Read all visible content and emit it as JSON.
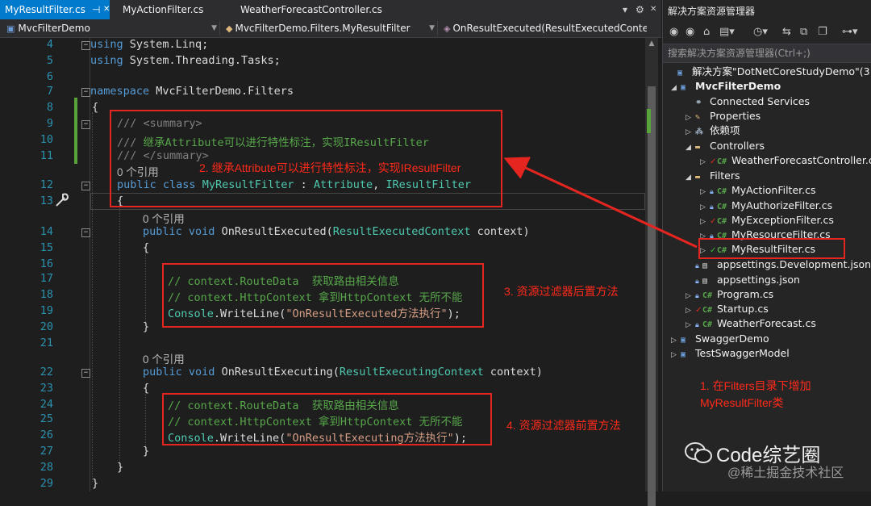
{
  "tabs": [
    {
      "label": "MyResultFilter.cs",
      "pin": "⊣",
      "close": "✕",
      "active": true
    },
    {
      "label": "MyActionFilter.cs",
      "active": false
    },
    {
      "label": "WeatherForecastController.cs",
      "active": false
    }
  ],
  "tab_controls": {
    "dropdown": "▾",
    "settings": "⚙",
    "close": "✕"
  },
  "navbar": {
    "project": "MvcFilterDemo",
    "type": "MvcFilterDemo.Filters.MyResultFilter",
    "member": "OnResultExecuted(ResultExecutedContext"
  },
  "code": {
    "line_numbers": [
      "4",
      "5",
      "6",
      "7",
      "8",
      "9",
      "10",
      "11",
      "12",
      "13",
      "14",
      "15",
      "16",
      "17",
      "18",
      "19",
      "20",
      "21",
      "22",
      "23",
      "24",
      "25",
      "26",
      "27",
      "28",
      "29"
    ],
    "using_kw": "using",
    "using1": "System.Linq;",
    "using2": "System.Threading.Tasks;",
    "namespace_kw": "namespace",
    "namespace_name": "MvcFilterDemo.Filters",
    "brace_open": "{",
    "brace_close": "}",
    "summary_prefix": "///",
    "summary_open": "<summary>",
    "summary_text": "继承Attribute可以进行特性标注，实现IResultFilter",
    "summary_close": "</summary>",
    "refs": "0 个引用",
    "public_kw": "public",
    "class_kw": "class",
    "class_name": "MyResultFilter",
    "colon": ":",
    "base1": "Attribute",
    "comma": ",",
    "base2": "IResultFilter",
    "void_kw": "void",
    "m1_name": "OnResultExecuted",
    "m1_ptype": "ResultExecutedContext",
    "param": "context)",
    "paren": "(",
    "m2_name": "OnResultExecuting",
    "m2_ptype": "ResultExecutingContext",
    "comment1": "// context.RouteData  获取路由相关信息",
    "comment2": "// context.HttpContext 拿到HttpContext 无所不能",
    "console": "Console",
    "writeline": ".WriteLine(",
    "str1": "\"OnResultExecuted方法执行\"",
    "str2": "\"OnResultExecuting方法执行\"",
    "stmt_end": ");"
  },
  "annotations": {
    "a1": "1. 在Filters目录下增加",
    "a1b": "MyResultFilter类",
    "a2": "2. 继承Attribute可以进行特性标注，实现IResultFilter",
    "a3": "3. 资源过滤器后置方法",
    "a4": "4. 资源过滤器前置方法"
  },
  "solution_explorer": {
    "title": "解决方案资源管理器",
    "search_placeholder": "搜索解决方案资源管理器(Ctrl+;)",
    "items": [
      {
        "label": "解决方案\"DotNetCoreStudyDemo\"(3 个项",
        "icon": "sln"
      },
      {
        "label": "MvcFilterDemo",
        "icon": "proj"
      },
      {
        "label": "Connected Services",
        "icon": "svc"
      },
      {
        "label": "Properties",
        "icon": "props"
      },
      {
        "label": "依赖项",
        "icon": "deps"
      },
      {
        "label": "Controllers",
        "icon": "folder"
      },
      {
        "label": "WeatherForecastController.cs",
        "icon": "cs"
      },
      {
        "label": "Filters",
        "icon": "folder"
      },
      {
        "label": "MyActionFilter.cs",
        "icon": "cs"
      },
      {
        "label": "MyAuthorizeFilter.cs",
        "icon": "cs"
      },
      {
        "label": "MyExceptionFilter.cs",
        "icon": "cs"
      },
      {
        "label": "MyResourceFilter.cs",
        "icon": "cs"
      },
      {
        "label": "MyResultFilter.cs",
        "icon": "cs"
      },
      {
        "label": "appsettings.Development.json",
        "icon": "json"
      },
      {
        "label": "appsettings.json",
        "icon": "json"
      },
      {
        "label": "Program.cs",
        "icon": "cs"
      },
      {
        "label": "Startup.cs",
        "icon": "cs"
      },
      {
        "label": "WeatherForecast.cs",
        "icon": "cs"
      },
      {
        "label": "SwaggerDemo",
        "icon": "proj"
      },
      {
        "label": "TestSwaggerModel",
        "icon": "proj"
      }
    ]
  },
  "watermark": {
    "brand": "Code综艺圈",
    "sub": "@稀土掘金技术社区"
  },
  "colors": {
    "accent": "#007acc",
    "annotation_red": "#e5251f",
    "comment_green": "#57a64a",
    "keyword_blue": "#569cd6",
    "type_teal": "#4ec9b0"
  }
}
